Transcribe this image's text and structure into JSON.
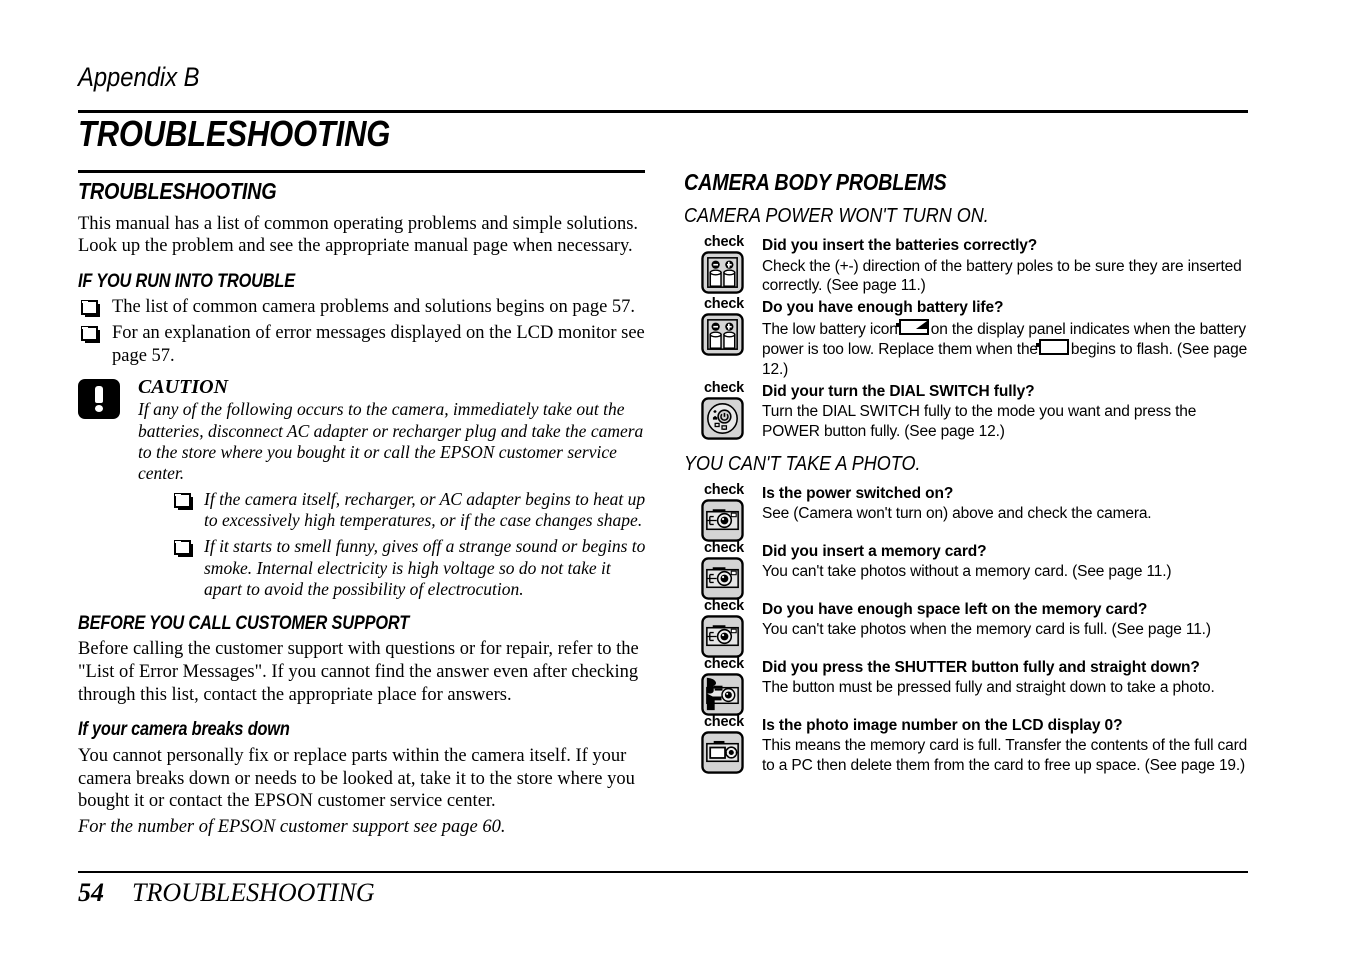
{
  "header": {
    "appendix_label": "Appendix B",
    "chapter_title": "TROUBLESHOOTING"
  },
  "left_column": {
    "section_title": "TROUBLESHOOTING",
    "intro": "This manual has a list of common operating problems and simple solutions. Look up the problem and see the appropriate manual page when necessary.",
    "sub1_title": "IF YOU RUN INTO TROUBLE",
    "sub1_bullets": [
      "The list of common camera problems and solutions begins on page 57.",
      "For an explanation of error messages displayed on the LCD monitor see page 57."
    ],
    "caution": {
      "title": "CAUTION",
      "body": "If any of the following occurs to the camera, immediately take out the batteries, disconnect AC adapter or recharger plug and take the camera to the store where you bought it or call the EPSON customer service center.",
      "bullets": [
        "If the camera itself, recharger, or AC adapter begins to heat up to excessively high temperatures, or if the case changes shape.",
        "If it starts to smell funny, gives off a strange sound or begins to smoke. Internal electricity is high voltage so do not take it apart to avoid the possibility of electrocution."
      ]
    },
    "sub2_title": "BEFORE YOU CALL CUSTOMER SUPPORT",
    "sub2_body": "Before calling the customer support with questions or for repair, refer to the \"List of Error Messages\". If you cannot find the answer even after checking through this list, contact the appropriate place for answers.",
    "sub3_title": "If your camera breaks down",
    "sub3_body": "You cannot personally fix or replace parts within the camera itself. If your camera breaks down or needs to be looked at, take it to the store where you bought it or contact the EPSON customer service center.",
    "sub3_note": "For the number of EPSON customer support see page 60."
  },
  "right_column": {
    "section_title": "CAMERA BODY PROBLEMS",
    "problem1_title": "CAMERA POWER WON'T TURN ON.",
    "problem1_items": [
      {
        "check_label": "check",
        "icon": "batteries-icon",
        "question": "Did you insert the batteries correctly?",
        "answer": "Check the (+-) direction of the battery poles to be sure they are inserted correctly. (See page 11.)"
      },
      {
        "check_label": "check",
        "icon": "batteries-icon",
        "question": "Do you have enough battery life?",
        "answer_part1": "The low battery icon",
        "answer_part2": "on the display panel indicates when the battery power is too low. Replace them when the",
        "answer_part3": "begins to flash. (See page 12.)"
      },
      {
        "check_label": "check",
        "icon": "dial-switch-icon",
        "question": "Did your turn the DIAL SWITCH fully?",
        "answer": "Turn the DIAL SWITCH fully to the mode you want and press the POWER button fully. (See page 12.)"
      }
    ],
    "problem2_title": "YOU CAN'T TAKE A PHOTO.",
    "problem2_items": [
      {
        "check_label": "check",
        "icon": "camera-front-icon",
        "question": "Is the power switched on?",
        "answer": "See (Camera won't turn on) above and check the camera."
      },
      {
        "check_label": "check",
        "icon": "camera-front-icon",
        "question": "Did you insert a memory card?",
        "answer": "You can't take photos without a memory card. (See page 11.)"
      },
      {
        "check_label": "check",
        "icon": "camera-front-icon",
        "question": "Do you have enough space left on the memory card?",
        "answer": "You can't take photos when the memory card is full. (See page 11.)"
      },
      {
        "check_label": "check",
        "icon": "shutter-press-icon",
        "question": "Did you press the SHUTTER button fully and straight down?",
        "answer": "The button must be pressed fully and straight down to take a photo."
      },
      {
        "check_label": "check",
        "icon": "camera-lcd-icon",
        "question": "Is the photo image number on the LCD display 0?",
        "answer": "This means the memory card is full. Transfer the contents of the full card to a PC then delete them from the card to free up space. (See page 19.)"
      }
    ]
  },
  "footer": {
    "page_number": "54",
    "title": "TROUBLESHOOTING"
  },
  "colors": {
    "text": "#000000",
    "page_background": "#ffffff",
    "icon_fill": "#d4d4d4",
    "icon_outline": "#000000"
  }
}
